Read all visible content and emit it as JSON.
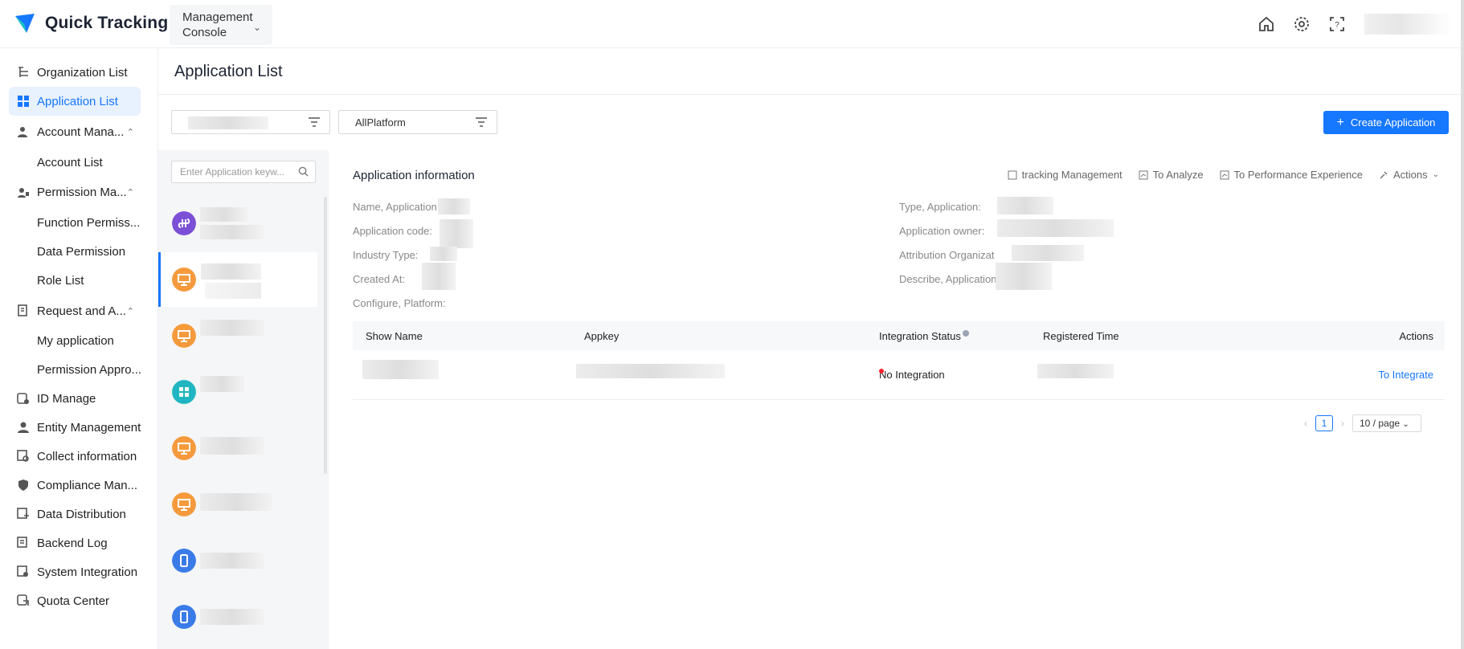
{
  "app": {
    "logo_text": "Quick Tracking",
    "console_label": "Management Console"
  },
  "sidebar": {
    "items": [
      {
        "label": "Organization List",
        "icon": "org-list-icon"
      },
      {
        "label": "Application List",
        "icon": "app-grid-icon",
        "active": true
      },
      {
        "label": "Account Mana...",
        "icon": "account-icon",
        "expanded": true
      },
      {
        "label": "Account List",
        "sub": true
      },
      {
        "label": "Permission Ma...",
        "icon": "permission-icon",
        "expanded": true
      },
      {
        "label": "Function Permiss...",
        "sub": true
      },
      {
        "label": "Data Permission",
        "sub": true
      },
      {
        "label": "Role List",
        "sub": true
      },
      {
        "label": "Request and A...",
        "icon": "request-icon",
        "expanded": true
      },
      {
        "label": "My application",
        "sub": true
      },
      {
        "label": "Permission Appro...",
        "sub": true
      },
      {
        "label": "ID Manage",
        "icon": "id-icon"
      },
      {
        "label": "Entity Management",
        "icon": "entity-icon"
      },
      {
        "label": "Collect information",
        "icon": "collect-icon"
      },
      {
        "label": "Compliance Man...",
        "icon": "shield-icon"
      },
      {
        "label": "Data Distribution",
        "icon": "distribution-icon"
      },
      {
        "label": "Backend Log",
        "icon": "log-icon"
      },
      {
        "label": "System Integration",
        "icon": "integration-icon"
      },
      {
        "label": "Quota Center",
        "icon": "quota-icon"
      }
    ]
  },
  "page": {
    "title": "Application List"
  },
  "filters": {
    "platform": "AllPlatform",
    "create_label": "Create Application",
    "search_placeholder": "Enter Application keyw..."
  },
  "colors": {
    "accent": "#1677ff",
    "purple": "#7b4fd6",
    "orange": "#f59a3c",
    "teal": "#1fb6c1",
    "blue": "#3a7be8"
  },
  "app_list": [
    {
      "icon": "miniprogram-icon",
      "color": "purple"
    },
    {
      "icon": "desktop-icon",
      "color": "orange",
      "selected": true
    },
    {
      "icon": "desktop-icon",
      "color": "orange"
    },
    {
      "icon": "windows-icon",
      "color": "teal"
    },
    {
      "icon": "desktop-icon",
      "color": "orange"
    },
    {
      "icon": "desktop-icon",
      "color": "orange"
    },
    {
      "icon": "mobile-icon",
      "color": "blue"
    },
    {
      "icon": "mobile-icon",
      "color": "blue"
    }
  ],
  "detail": {
    "section_title": "Application information",
    "actions": [
      "tracking Management",
      "To Analyze",
      "To Performance Experience",
      "Actions"
    ],
    "fields_left": [
      "Name, Application:",
      "Application code:",
      "Industry Type:",
      "Created At:",
      "Configure, Platform:"
    ],
    "fields_right": [
      "Type, Application:",
      "Application owner:",
      "Attribution Organizat",
      "Describe, Application"
    ],
    "table": {
      "headers": [
        "Show Name",
        "Appkey",
        "Integration Status",
        "Registered Time",
        "Actions"
      ],
      "row": {
        "status": "No Integration",
        "action": "To Integrate"
      }
    },
    "pager": {
      "page": "1",
      "size": "10 / page"
    }
  }
}
